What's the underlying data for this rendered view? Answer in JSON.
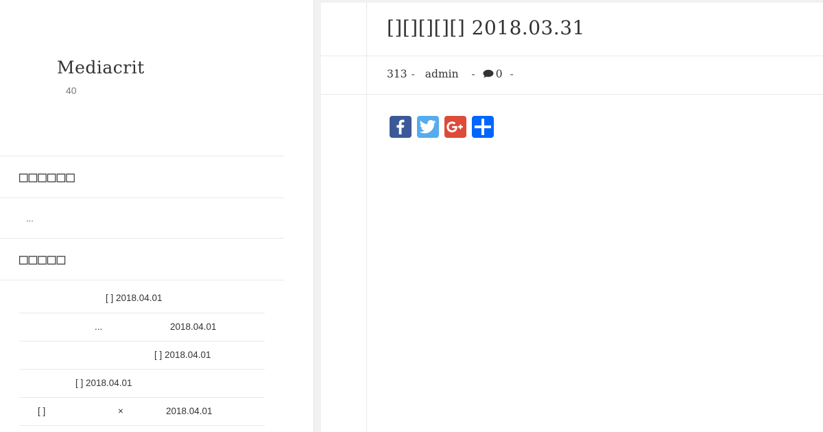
{
  "sidebar": {
    "site_title": "Mediacrit",
    "site_subtitle": "40",
    "widget1": {
      "title": "",
      "text": "..."
    },
    "widget2": {
      "title": "",
      "posts": [
        {
          "a": "[ ] 2018.04.01",
          "b": "",
          "c": ""
        },
        {
          "a": "...",
          "b": "2018.04.01",
          "c": ""
        },
        {
          "a": "[ ] 2018.04.01",
          "b": "",
          "c": ""
        },
        {
          "a": "[ ] 2018.04.01",
          "b": "",
          "c": ""
        },
        {
          "a": "[ ]",
          "b": "×",
          "c": "2018.04.01"
        }
      ]
    }
  },
  "post": {
    "title": "[][][][][] 2018.03.31",
    "meta": {
      "views": "313",
      "author": "admin",
      "comments": "0",
      "separator": "-"
    },
    "share": [
      {
        "name": "Facebook",
        "color": "#3b5998",
        "icon": "facebook-icon"
      },
      {
        "name": "Twitter",
        "color": "#55acee",
        "icon": "twitter-icon"
      },
      {
        "name": "Google+",
        "color": "#dd4b39",
        "icon": "google-plus-icon"
      },
      {
        "name": "Share",
        "color": "#0166ff",
        "icon": "share-plus-icon"
      }
    ]
  }
}
